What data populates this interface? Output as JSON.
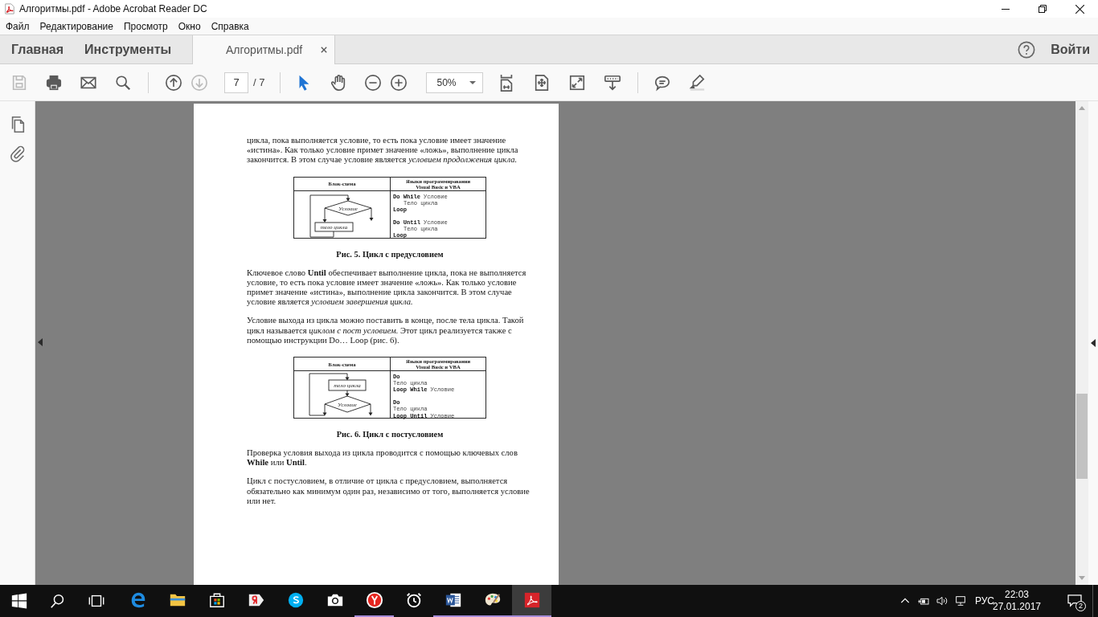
{
  "window": {
    "title": "Алгоритмы.pdf - Adobe Acrobat Reader DC"
  },
  "menu": [
    "Файл",
    "Редактирование",
    "Просмотр",
    "Окно",
    "Справка"
  ],
  "tabs": [
    {
      "kind": "nav",
      "label": "Главная",
      "selected": false
    },
    {
      "kind": "nav",
      "label": "Инструменты",
      "selected": false
    },
    {
      "kind": "document",
      "label": "Алгоритмы.pdf",
      "selected": true
    }
  ],
  "account": {
    "sign_in": "Войти"
  },
  "toolbar": {
    "file_tools": [
      {
        "kind": "save",
        "disabled": true
      },
      {
        "kind": "print",
        "disabled": false
      },
      {
        "kind": "email",
        "disabled": false
      },
      {
        "kind": "search",
        "disabled": false
      }
    ],
    "page_nav": [
      {
        "kind": "previous",
        "disabled": false
      },
      {
        "kind": "next",
        "disabled": true
      }
    ],
    "page": "7",
    "page_count": "/ 7",
    "tools": [
      {
        "kind": "select",
        "selected": true
      },
      {
        "kind": "hand",
        "selected": false
      }
    ],
    "zoom_buttons": [
      {
        "kind": "zoom_out"
      },
      {
        "kind": "zoom_in"
      }
    ],
    "zoom": "50%",
    "view_tools": [
      {
        "kind": "fit_width"
      },
      {
        "kind": "fit_page"
      },
      {
        "kind": "full_screen"
      },
      {
        "kind": "scroll_mode"
      }
    ],
    "annotate_tools": [
      {
        "kind": "comment"
      },
      {
        "kind": "highlight"
      }
    ]
  },
  "side_panel": [
    {
      "kind": "pages"
    },
    {
      "kind": "attachments"
    }
  ],
  "document": {
    "blocks": [
      {
        "kind": "paragraph",
        "text": "цикла, пока выполняется условие, то есть пока условие имеет значение «истина». Как только условие примет значение «ложь», выполнение цикла закончится. В этом случае условие является *условием продолжения цикла.*"
      },
      {
        "kind": "figure",
        "headers": [
          "Блок-схема",
          "Языки программирования Visual Basic и VBA"
        ],
        "flowchart": {
          "kind": "pre_test",
          "condition": "Условие",
          "body": "тело цикла"
        },
        "code": [
          [
            {
              "keyword": "Do While",
              "text": "Условие",
              "children": [
                {
                  "text": "Тело цикла"
                }
              ]
            },
            {
              "keyword": "Loop"
            }
          ],
          [
            {
              "keyword": "Do Until",
              "text": "Условие",
              "children": [
                {
                  "text": "Тело цикла"
                }
              ]
            },
            {
              "keyword": "Loop"
            }
          ]
        ]
      },
      {
        "kind": "caption",
        "text": "Рис. 5. Цикл с предусловием"
      },
      {
        "kind": "paragraph",
        "text": "Ключевое слово **Until** обеспечивает выполнение цикла, пока не выполняется условие, то есть пока условие имеет значение «ложь». Как только условие примет значение «истина», выполнение цикла закончится. В этом случае условие является *условием завершения цикла.*"
      },
      {
        "kind": "paragraph",
        "text": "Условие выхода из цикла можно поставить в конце, после тела цикла. Такой цикл называется *циклом с пост условием.* Этот цикл реализуется также с помощью инструкции Do… Loop (рис. 6)."
      },
      {
        "kind": "figure",
        "headers": [
          "Блок-схема",
          "Языки программирования Visual Basic и VBA"
        ],
        "flowchart": {
          "kind": "post_test",
          "condition": "Условие",
          "body": "тело цикла"
        },
        "code": [
          [
            {
              "keyword": "Do"
            },
            {
              "text": "Тело цикла"
            },
            {
              "keyword": "Loop While",
              "text": "Условие"
            }
          ],
          [
            {
              "keyword": "Do"
            },
            {
              "text": "Тело цикла"
            },
            {
              "keyword": "Loop Until",
              "text": "Условие"
            }
          ]
        ]
      },
      {
        "kind": "caption",
        "text": "Рис. 6. Цикл с постусловием"
      },
      {
        "kind": "paragraph",
        "text": "Проверка условия выхода из цикла проводится с помощью ключевых слов **While** или **Until**."
      },
      {
        "kind": "paragraph",
        "text": "Цикл с постусловием, в отличие от цикла с предусловием, выполняется обязательно как минимум один раз, независимо от того, выполняется условие или нет."
      }
    ]
  },
  "taskbar": {
    "system": [
      {
        "kind": "start"
      },
      {
        "kind": "search"
      },
      {
        "kind": "task_view"
      }
    ],
    "apps": [
      {
        "kind": "edge",
        "open": false,
        "selected": false
      },
      {
        "kind": "explorer",
        "open": false,
        "selected": false
      },
      {
        "kind": "store",
        "open": false,
        "selected": false
      },
      {
        "kind": "yandex",
        "open": false,
        "selected": false
      },
      {
        "kind": "skype",
        "open": false,
        "selected": false
      },
      {
        "kind": "camera",
        "open": false,
        "selected": false
      },
      {
        "kind": "yandex_browser",
        "open": true,
        "selected": false
      },
      {
        "kind": "alarms",
        "open": false,
        "selected": false
      },
      {
        "kind": "word",
        "open": true,
        "selected": false
      },
      {
        "kind": "paint",
        "open": true,
        "selected": false
      },
      {
        "kind": "acrobat",
        "open": true,
        "selected": true
      }
    ],
    "tray": {
      "icons": [
        {
          "kind": "chevron"
        },
        {
          "kind": "power"
        },
        {
          "kind": "volume"
        },
        {
          "kind": "network"
        }
      ],
      "language": "РУС",
      "time": "22:03",
      "date": "27.01.2017",
      "notifications": "2"
    }
  }
}
